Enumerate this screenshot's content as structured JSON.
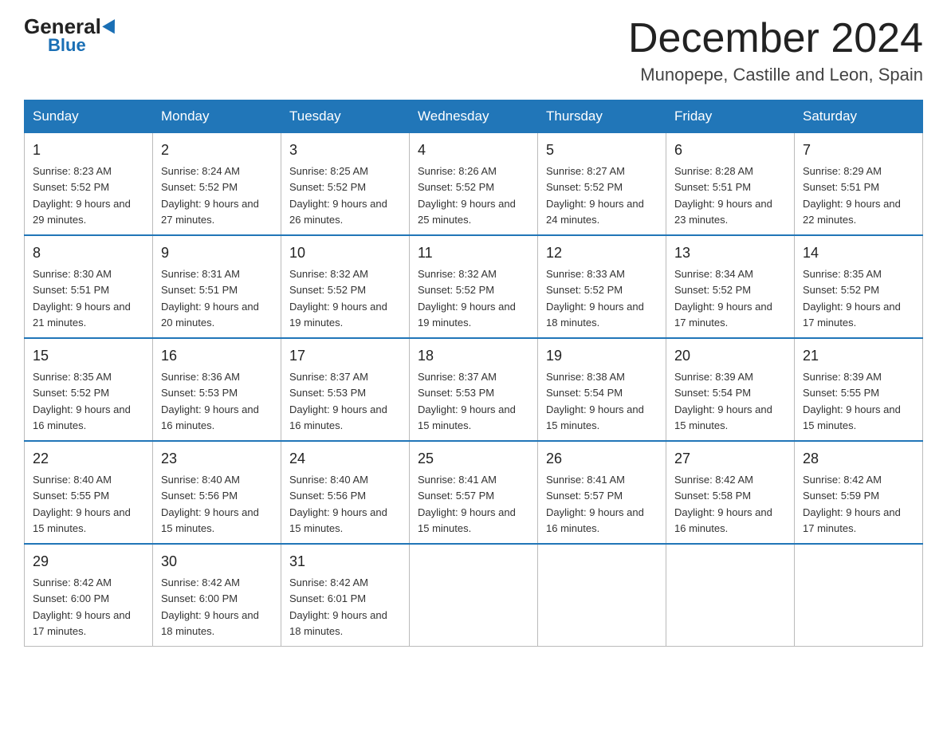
{
  "logo": {
    "general": "General",
    "blue": "Blue",
    "triangle": "▶"
  },
  "title": "December 2024",
  "location": "Munopepe, Castille and Leon, Spain",
  "days_of_week": [
    "Sunday",
    "Monday",
    "Tuesday",
    "Wednesday",
    "Thursday",
    "Friday",
    "Saturday"
  ],
  "weeks": [
    [
      {
        "day": "1",
        "sunrise": "8:23 AM",
        "sunset": "5:52 PM",
        "daylight": "9 hours and 29 minutes."
      },
      {
        "day": "2",
        "sunrise": "8:24 AM",
        "sunset": "5:52 PM",
        "daylight": "9 hours and 27 minutes."
      },
      {
        "day": "3",
        "sunrise": "8:25 AM",
        "sunset": "5:52 PM",
        "daylight": "9 hours and 26 minutes."
      },
      {
        "day": "4",
        "sunrise": "8:26 AM",
        "sunset": "5:52 PM",
        "daylight": "9 hours and 25 minutes."
      },
      {
        "day": "5",
        "sunrise": "8:27 AM",
        "sunset": "5:52 PM",
        "daylight": "9 hours and 24 minutes."
      },
      {
        "day": "6",
        "sunrise": "8:28 AM",
        "sunset": "5:51 PM",
        "daylight": "9 hours and 23 minutes."
      },
      {
        "day": "7",
        "sunrise": "8:29 AM",
        "sunset": "5:51 PM",
        "daylight": "9 hours and 22 minutes."
      }
    ],
    [
      {
        "day": "8",
        "sunrise": "8:30 AM",
        "sunset": "5:51 PM",
        "daylight": "9 hours and 21 minutes."
      },
      {
        "day": "9",
        "sunrise": "8:31 AM",
        "sunset": "5:51 PM",
        "daylight": "9 hours and 20 minutes."
      },
      {
        "day": "10",
        "sunrise": "8:32 AM",
        "sunset": "5:52 PM",
        "daylight": "9 hours and 19 minutes."
      },
      {
        "day": "11",
        "sunrise": "8:32 AM",
        "sunset": "5:52 PM",
        "daylight": "9 hours and 19 minutes."
      },
      {
        "day": "12",
        "sunrise": "8:33 AM",
        "sunset": "5:52 PM",
        "daylight": "9 hours and 18 minutes."
      },
      {
        "day": "13",
        "sunrise": "8:34 AM",
        "sunset": "5:52 PM",
        "daylight": "9 hours and 17 minutes."
      },
      {
        "day": "14",
        "sunrise": "8:35 AM",
        "sunset": "5:52 PM",
        "daylight": "9 hours and 17 minutes."
      }
    ],
    [
      {
        "day": "15",
        "sunrise": "8:35 AM",
        "sunset": "5:52 PM",
        "daylight": "9 hours and 16 minutes."
      },
      {
        "day": "16",
        "sunrise": "8:36 AM",
        "sunset": "5:53 PM",
        "daylight": "9 hours and 16 minutes."
      },
      {
        "day": "17",
        "sunrise": "8:37 AM",
        "sunset": "5:53 PM",
        "daylight": "9 hours and 16 minutes."
      },
      {
        "day": "18",
        "sunrise": "8:37 AM",
        "sunset": "5:53 PM",
        "daylight": "9 hours and 15 minutes."
      },
      {
        "day": "19",
        "sunrise": "8:38 AM",
        "sunset": "5:54 PM",
        "daylight": "9 hours and 15 minutes."
      },
      {
        "day": "20",
        "sunrise": "8:39 AM",
        "sunset": "5:54 PM",
        "daylight": "9 hours and 15 minutes."
      },
      {
        "day": "21",
        "sunrise": "8:39 AM",
        "sunset": "5:55 PM",
        "daylight": "9 hours and 15 minutes."
      }
    ],
    [
      {
        "day": "22",
        "sunrise": "8:40 AM",
        "sunset": "5:55 PM",
        "daylight": "9 hours and 15 minutes."
      },
      {
        "day": "23",
        "sunrise": "8:40 AM",
        "sunset": "5:56 PM",
        "daylight": "9 hours and 15 minutes."
      },
      {
        "day": "24",
        "sunrise": "8:40 AM",
        "sunset": "5:56 PM",
        "daylight": "9 hours and 15 minutes."
      },
      {
        "day": "25",
        "sunrise": "8:41 AM",
        "sunset": "5:57 PM",
        "daylight": "9 hours and 15 minutes."
      },
      {
        "day": "26",
        "sunrise": "8:41 AM",
        "sunset": "5:57 PM",
        "daylight": "9 hours and 16 minutes."
      },
      {
        "day": "27",
        "sunrise": "8:42 AM",
        "sunset": "5:58 PM",
        "daylight": "9 hours and 16 minutes."
      },
      {
        "day": "28",
        "sunrise": "8:42 AM",
        "sunset": "5:59 PM",
        "daylight": "9 hours and 17 minutes."
      }
    ],
    [
      {
        "day": "29",
        "sunrise": "8:42 AM",
        "sunset": "6:00 PM",
        "daylight": "9 hours and 17 minutes."
      },
      {
        "day": "30",
        "sunrise": "8:42 AM",
        "sunset": "6:00 PM",
        "daylight": "9 hours and 18 minutes."
      },
      {
        "day": "31",
        "sunrise": "8:42 AM",
        "sunset": "6:01 PM",
        "daylight": "9 hours and 18 minutes."
      },
      null,
      null,
      null,
      null
    ]
  ]
}
